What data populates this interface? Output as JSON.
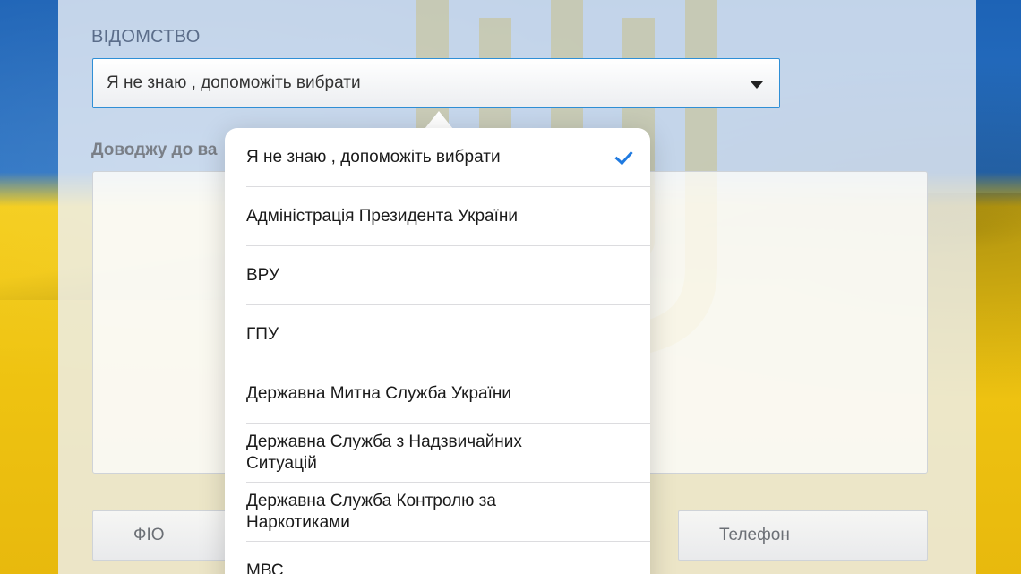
{
  "form": {
    "agency_label": "ВІДОМСТВО",
    "agency_selected": "Я не знаю , допоможіть вибрати",
    "message_label": "Доводжу до ва",
    "fio_placeholder": "ФІО",
    "phone_placeholder": "Телефон"
  },
  "dropdown": {
    "selected_index": 0,
    "options": [
      "Я не знаю , допоможіть вибрати",
      "Адміністрація Президента України",
      "ВРУ",
      "ГПУ",
      "Державна Митна Служба України",
      "Державна Служба з Надзвичайних Ситуацій",
      "Державна Служба Контролю за Наркотиками",
      "МВС"
    ]
  },
  "icons": {
    "caret": "chevron-down-icon",
    "check": "checkmark-icon",
    "background_emblem": "trident-emblem"
  },
  "colors": {
    "flag_blue": "#1d63b6",
    "flag_yellow": "#f4cc15",
    "select_border": "#2f8fd6",
    "check": "#1f7ae0"
  }
}
